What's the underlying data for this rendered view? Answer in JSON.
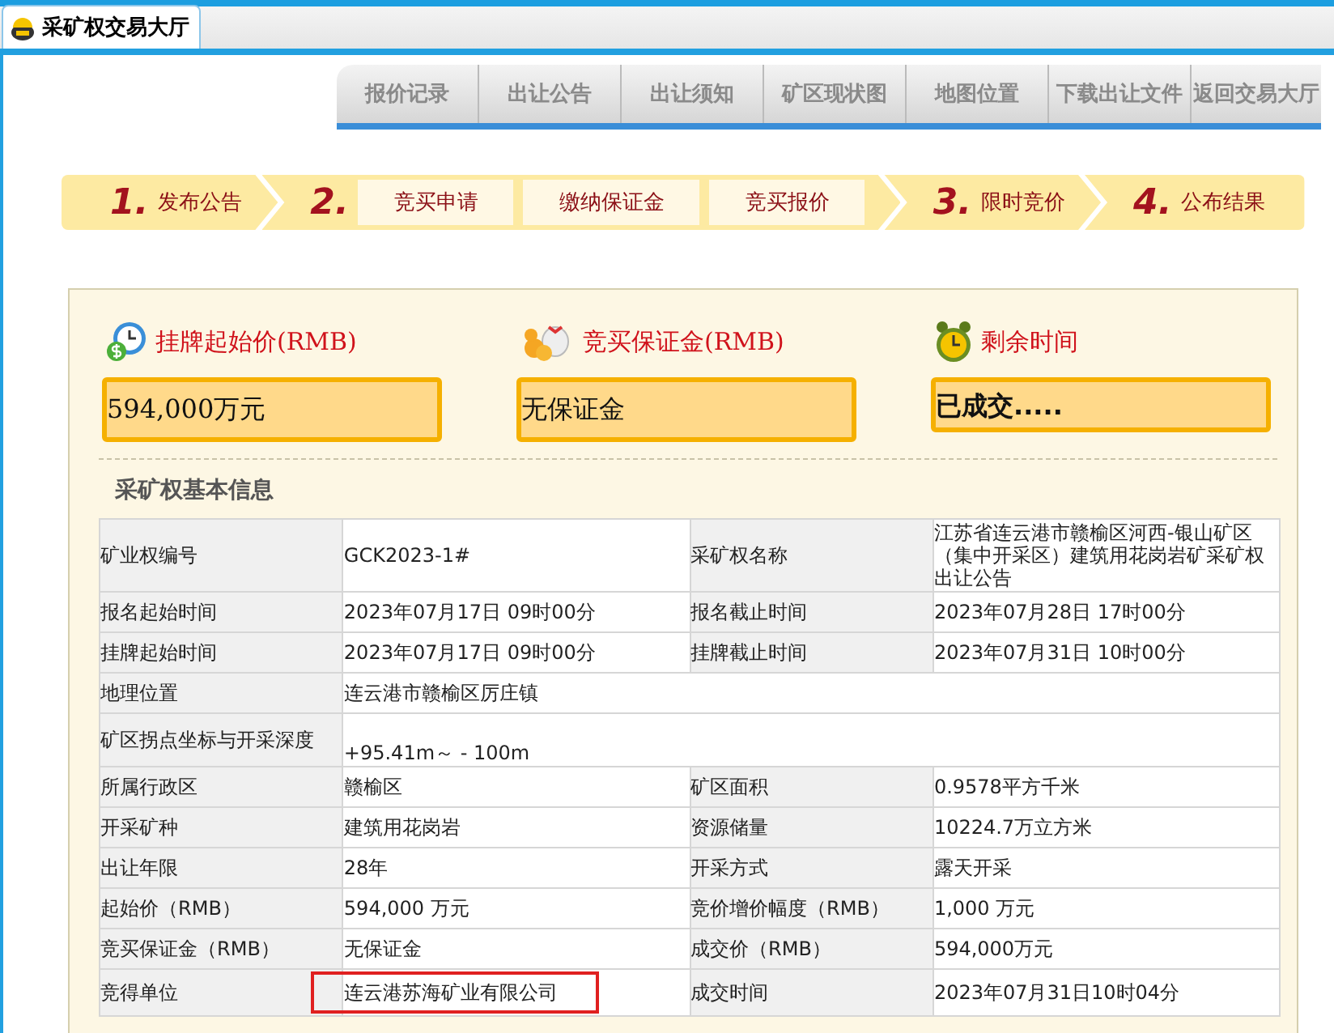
{
  "browser_tab": {
    "title": "采矿权交易大厅"
  },
  "nav_tabs": [
    {
      "label": "报价记录"
    },
    {
      "label": "出让公告"
    },
    {
      "label": "出让须知"
    },
    {
      "label": "矿区现状图"
    },
    {
      "label": "地图位置"
    },
    {
      "label": "下载出让文件"
    },
    {
      "label": "返回交易大厅"
    }
  ],
  "steps": [
    {
      "number": "1.",
      "label": "发布公告"
    },
    {
      "number": "2.",
      "substeps": [
        "竞买申请",
        "缴纳保证金",
        "竞买报价"
      ]
    },
    {
      "number": "3.",
      "label": "限时竞价"
    },
    {
      "number": "4.",
      "label": "公布结果"
    }
  ],
  "summary": [
    {
      "kind": "price",
      "title": "挂牌起始价(RMB)",
      "value": "594,000万元"
    },
    {
      "kind": "deposit",
      "title": "竞买保证金(RMB)",
      "value": "无保证金"
    },
    {
      "kind": "time",
      "title": "剩余时间",
      "value": "已成交....."
    }
  ],
  "section_title": "采矿权基本信息",
  "table": {
    "rows": [
      {
        "cells": [
          "矿业权编号",
          "GCK2023-1#",
          "采矿权名称",
          "江苏省连云港市赣榆区河西-银山矿区（集中开采区）建筑用花岗岩矿采矿权出让公告"
        ],
        "highlighted": false
      },
      {
        "cells": [
          "报名起始时间",
          "2023年07月17日 09时00分",
          "报名截止时间",
          "2023年07月28日 17时00分"
        ],
        "highlighted": false
      },
      {
        "cells": [
          "挂牌起始时间",
          "2023年07月17日 09时00分",
          "挂牌截止时间",
          "2023年07月31日 10时00分"
        ],
        "highlighted": false
      },
      {
        "cells": [
          "地理位置",
          "连云港市赣榆区厉庄镇"
        ],
        "highlighted": false
      },
      {
        "cells": [
          "矿区拐点坐标与开采深度",
          "+95.41m～ - 100m"
        ],
        "highlighted": false
      },
      {
        "cells": [
          "所属行政区",
          "赣榆区",
          "矿区面积",
          "0.9578平方千米"
        ],
        "highlighted": false
      },
      {
        "cells": [
          "开采矿种",
          "建筑用花岗岩",
          "资源储量",
          "10224.7万立方米"
        ],
        "highlighted": false
      },
      {
        "cells": [
          "出让年限",
          "28年",
          "开采方式",
          "露天开采"
        ],
        "highlighted": false
      },
      {
        "cells": [
          "起始价（RMB）",
          "594,000 万元",
          "竞价增价幅度（RMB）",
          "1,000 万元"
        ],
        "highlighted": false
      },
      {
        "cells": [
          "竞买保证金（RMB）",
          "无保证金",
          "成交价（RMB）",
          "594,000万元"
        ],
        "highlighted": false
      },
      {
        "cells": [
          "竞得单位",
          "连云港苏海矿业有限公司",
          "成交时间",
          "2023年07月31日10时04分"
        ],
        "highlighted": true
      }
    ]
  }
}
